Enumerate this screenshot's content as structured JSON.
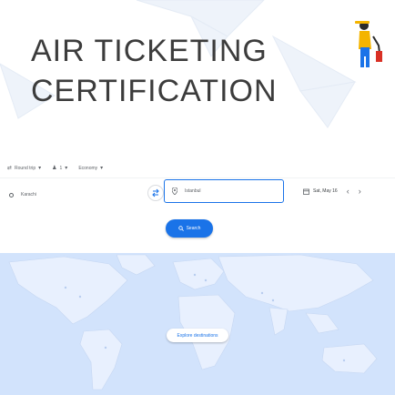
{
  "page_title_line1": "AIR TICKETING",
  "page_title_line2": "CERTIFICATION",
  "search_options": {
    "trip_type": "Round trip",
    "passengers": "1",
    "cabin_class": "Economy"
  },
  "search_form": {
    "origin": "Karachi",
    "destination": "Istanbul",
    "departure_date": "Sat, May 16",
    "search_label": "Search",
    "explore_label": "Explore destinations"
  },
  "colors": {
    "accent": "#1a73e8",
    "title_text": "#3c3c3c",
    "map_water": "#d2e3fc",
    "map_land": "#e8f0fe"
  },
  "icons": [
    "round-trip-icon",
    "person-icon",
    "origin-circle-icon",
    "swap-icon",
    "location-pin-icon",
    "calendar-icon",
    "chevron-left-icon",
    "chevron-right-icon",
    "search-icon",
    "traveler-figure-icon"
  ]
}
